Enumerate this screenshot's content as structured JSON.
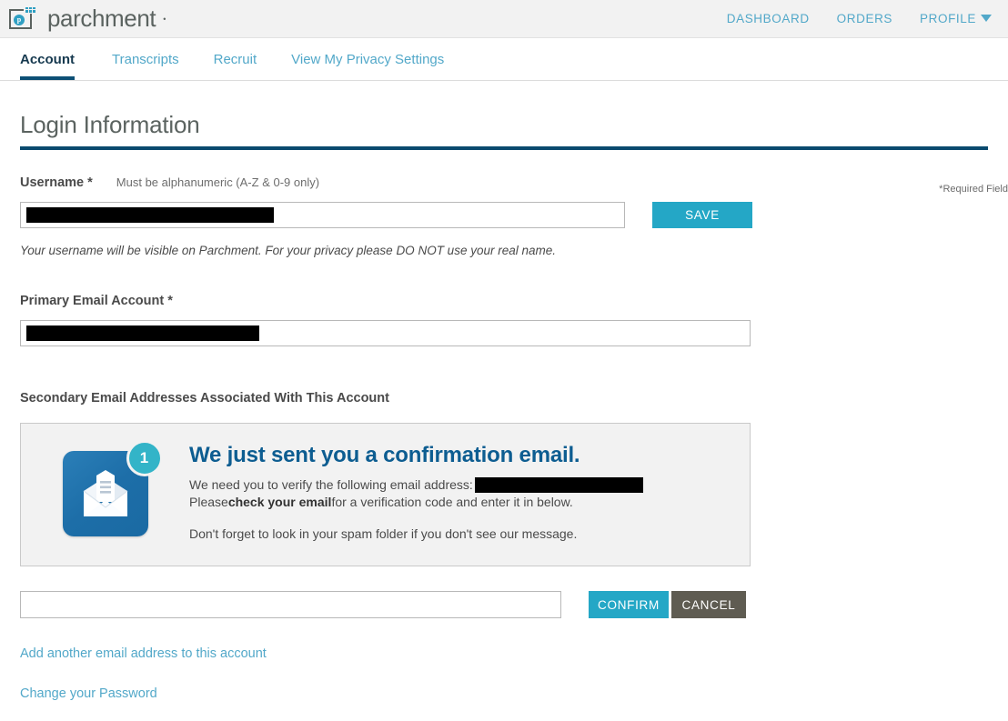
{
  "brand": {
    "name": "parchment",
    "trademark": "™",
    "logo_letter": "p",
    "accent_teal": "#24a7c6",
    "accent_navy": "#0a4a6e",
    "accent_blue": "#0d5d91"
  },
  "top_nav": {
    "items": [
      {
        "label": "DASHBOARD",
        "has_caret": false
      },
      {
        "label": "ORDERS",
        "has_caret": false
      },
      {
        "label": "PROFILE",
        "has_caret": true
      }
    ]
  },
  "tabs": [
    {
      "label": "Account",
      "active": true
    },
    {
      "label": "Transcripts",
      "active": false
    },
    {
      "label": "Recruit",
      "active": false
    },
    {
      "label": "View My Privacy Settings",
      "active": false
    }
  ],
  "page": {
    "title": "Login Information",
    "required_note": "*Required Field"
  },
  "username": {
    "label": "Username *",
    "hint": "Must be alphanumeric (A-Z & 0-9 only)",
    "value": "",
    "placeholder": "",
    "redacted": true,
    "save_label": "SAVE",
    "helper": "Your username will be visible on Parchment. For your privacy please DO NOT use your real name."
  },
  "primary_email": {
    "label": "Primary Email Account *",
    "value": "",
    "placeholder": "",
    "redacted": true
  },
  "secondary_email": {
    "section_label": "Secondary Email Addresses Associated With This Account"
  },
  "confirmation_panel": {
    "icon_name": "open-envelope-with-document-icon",
    "badge_count": "1",
    "heading": "We just sent you a confirmation email.",
    "line1_prefix": "We need you to verify the following email address:",
    "line1_value_redacted": true,
    "line2_prefix": "Please ",
    "line2_bold": "check your email",
    "line2_suffix": " for a verification code and enter it in below.",
    "spam_note": "Don't forget to look in your spam folder if you don't see our message."
  },
  "verification": {
    "value": "",
    "placeholder": "",
    "confirm_label": "CONFIRM",
    "cancel_label": "CANCEL"
  },
  "links": {
    "add_email": "Add another email address to this account",
    "change_password": "Change your Password"
  }
}
